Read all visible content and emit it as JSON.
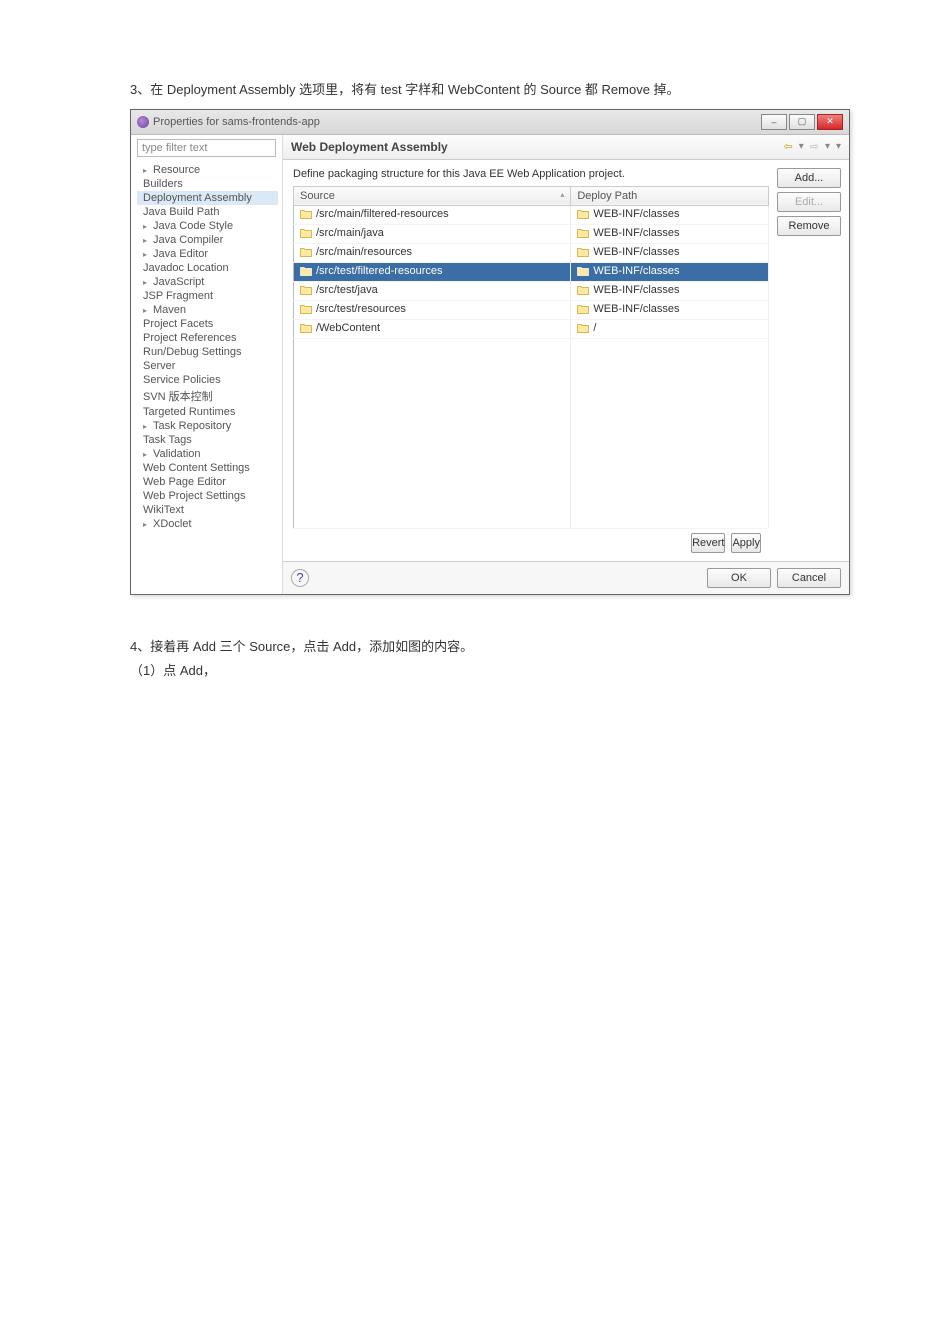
{
  "captions": {
    "c3": "3、在 Deployment Assembly 选项里，将有 test 字样和 WebContent 的 Source 都 Remove 掉。",
    "c4": "4、接着再 Add 三个 Source，点击 Add，添加如图的内容。",
    "c4a": "（1）点 Add，"
  },
  "window": {
    "title": "Properties for sams-frontends-app",
    "filter_placeholder": "type filter text",
    "main_title": "Web Deployment Assembly",
    "description": "Define packaging structure for this Java EE Web Application project.",
    "columns": {
      "source": "Source",
      "deploy": "Deploy Path"
    },
    "buttons": {
      "add": "Add...",
      "edit": "Edit...",
      "remove": "Remove",
      "revert": "Revert",
      "apply": "Apply",
      "ok": "OK",
      "cancel": "Cancel"
    }
  },
  "tree": [
    {
      "label": "Resource",
      "exp": true
    },
    {
      "label": "Builders"
    },
    {
      "label": "Deployment Assembly",
      "sel": true
    },
    {
      "label": "Java Build Path"
    },
    {
      "label": "Java Code Style",
      "exp": true
    },
    {
      "label": "Java Compiler",
      "exp": true
    },
    {
      "label": "Java Editor",
      "exp": true
    },
    {
      "label": "Javadoc Location"
    },
    {
      "label": "JavaScript",
      "exp": true
    },
    {
      "label": "JSP Fragment"
    },
    {
      "label": "Maven",
      "exp": true
    },
    {
      "label": "Project Facets"
    },
    {
      "label": "Project References"
    },
    {
      "label": "Run/Debug Settings"
    },
    {
      "label": "Server"
    },
    {
      "label": "Service Policies"
    },
    {
      "label": "SVN 版本控制"
    },
    {
      "label": "Targeted Runtimes"
    },
    {
      "label": "Task Repository",
      "exp": true
    },
    {
      "label": "Task Tags"
    },
    {
      "label": "Validation",
      "exp": true
    },
    {
      "label": "Web Content Settings"
    },
    {
      "label": "Web Page Editor"
    },
    {
      "label": "Web Project Settings"
    },
    {
      "label": "WikiText"
    },
    {
      "label": "XDoclet",
      "exp": true
    }
  ],
  "rows": [
    {
      "src": "/src/main/filtered-resources",
      "dep": "WEB-INF/classes"
    },
    {
      "src": "/src/main/java",
      "dep": "WEB-INF/classes"
    },
    {
      "src": "/src/main/resources",
      "dep": "WEB-INF/classes"
    },
    {
      "src": "/src/test/filtered-resources",
      "dep": "WEB-INF/classes",
      "sel": true
    },
    {
      "src": "/src/test/java",
      "dep": "WEB-INF/classes"
    },
    {
      "src": "/src/test/resources",
      "dep": "WEB-INF/classes"
    },
    {
      "src": "/WebContent",
      "dep": "/"
    }
  ]
}
